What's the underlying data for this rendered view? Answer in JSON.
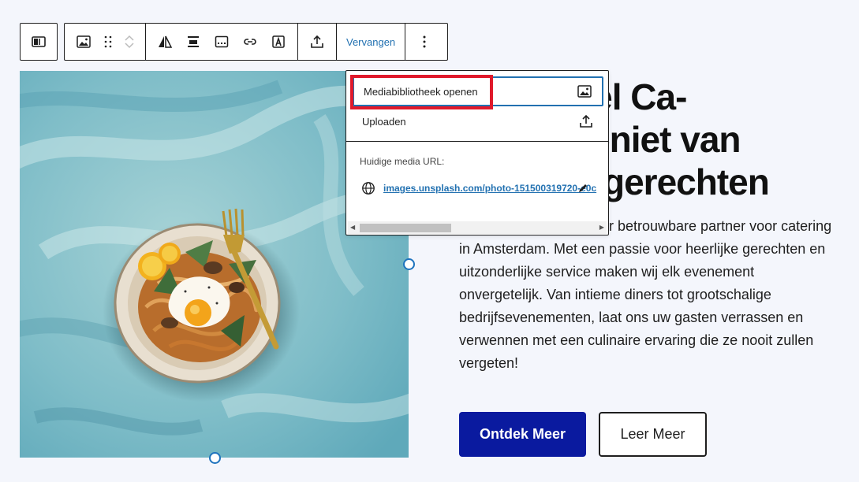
{
  "toolbar": {
    "replace_label": "Vervangen"
  },
  "dropdown": {
    "open_library_label": "Mediabibliotheek openen",
    "upload_label": "Uploaden",
    "current_url_label": "Huidige media URL:",
    "current_url": "images.unsplash.com/photo-151500319720-e0c"
  },
  "content": {
    "heading_lines": [
      "r TopTafel Ca-",
      "geniet van",
      "gerechten"
    ],
    "body_lines": [
      "r betrouwbare partner voor catering",
      "in Amsterdam. Met een passie voor heerlijke gerechten en",
      "uitzonderlijke service maken wij elk evenement",
      "onvergetelijk. Van intieme diners tot grootschalige",
      "bedrijfsevenementen, laat ons uw gasten verrassen en",
      "verwennen met een culinaire ervaring die ze nooit zullen",
      "vergeten!"
    ],
    "primary_button": "Ontdek Meer",
    "secondary_button": "Leer Meer"
  },
  "colors": {
    "accent": "#2271b1",
    "primary_button_bg": "#0a1a9f",
    "highlight": "#e0192b"
  }
}
